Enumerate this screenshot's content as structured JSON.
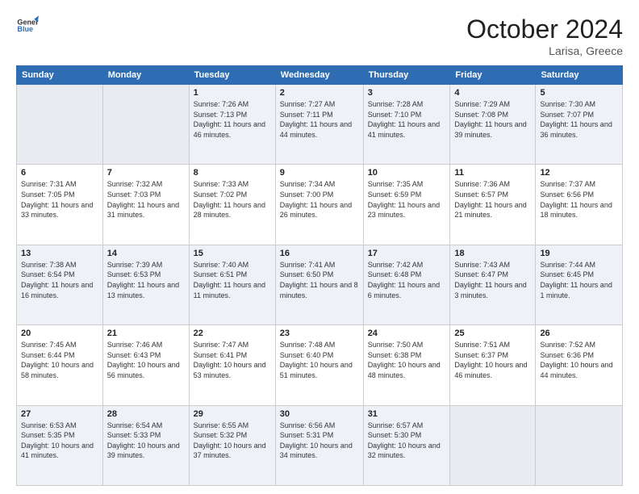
{
  "header": {
    "logo_general": "General",
    "logo_blue": "Blue",
    "month_title": "October 2024",
    "location": "Larisa, Greece"
  },
  "weekdays": [
    "Sunday",
    "Monday",
    "Tuesday",
    "Wednesday",
    "Thursday",
    "Friday",
    "Saturday"
  ],
  "weeks": [
    [
      {
        "day": "",
        "info": ""
      },
      {
        "day": "",
        "info": ""
      },
      {
        "day": "1",
        "info": "Sunrise: 7:26 AM\nSunset: 7:13 PM\nDaylight: 11 hours\nand 46 minutes."
      },
      {
        "day": "2",
        "info": "Sunrise: 7:27 AM\nSunset: 7:11 PM\nDaylight: 11 hours\nand 44 minutes."
      },
      {
        "day": "3",
        "info": "Sunrise: 7:28 AM\nSunset: 7:10 PM\nDaylight: 11 hours\nand 41 minutes."
      },
      {
        "day": "4",
        "info": "Sunrise: 7:29 AM\nSunset: 7:08 PM\nDaylight: 11 hours\nand 39 minutes."
      },
      {
        "day": "5",
        "info": "Sunrise: 7:30 AM\nSunset: 7:07 PM\nDaylight: 11 hours\nand 36 minutes."
      }
    ],
    [
      {
        "day": "6",
        "info": "Sunrise: 7:31 AM\nSunset: 7:05 PM\nDaylight: 11 hours\nand 33 minutes."
      },
      {
        "day": "7",
        "info": "Sunrise: 7:32 AM\nSunset: 7:03 PM\nDaylight: 11 hours\nand 31 minutes."
      },
      {
        "day": "8",
        "info": "Sunrise: 7:33 AM\nSunset: 7:02 PM\nDaylight: 11 hours\nand 28 minutes."
      },
      {
        "day": "9",
        "info": "Sunrise: 7:34 AM\nSunset: 7:00 PM\nDaylight: 11 hours\nand 26 minutes."
      },
      {
        "day": "10",
        "info": "Sunrise: 7:35 AM\nSunset: 6:59 PM\nDaylight: 11 hours\nand 23 minutes."
      },
      {
        "day": "11",
        "info": "Sunrise: 7:36 AM\nSunset: 6:57 PM\nDaylight: 11 hours\nand 21 minutes."
      },
      {
        "day": "12",
        "info": "Sunrise: 7:37 AM\nSunset: 6:56 PM\nDaylight: 11 hours\nand 18 minutes."
      }
    ],
    [
      {
        "day": "13",
        "info": "Sunrise: 7:38 AM\nSunset: 6:54 PM\nDaylight: 11 hours\nand 16 minutes."
      },
      {
        "day": "14",
        "info": "Sunrise: 7:39 AM\nSunset: 6:53 PM\nDaylight: 11 hours\nand 13 minutes."
      },
      {
        "day": "15",
        "info": "Sunrise: 7:40 AM\nSunset: 6:51 PM\nDaylight: 11 hours\nand 11 minutes."
      },
      {
        "day": "16",
        "info": "Sunrise: 7:41 AM\nSunset: 6:50 PM\nDaylight: 11 hours\nand 8 minutes."
      },
      {
        "day": "17",
        "info": "Sunrise: 7:42 AM\nSunset: 6:48 PM\nDaylight: 11 hours\nand 6 minutes."
      },
      {
        "day": "18",
        "info": "Sunrise: 7:43 AM\nSunset: 6:47 PM\nDaylight: 11 hours\nand 3 minutes."
      },
      {
        "day": "19",
        "info": "Sunrise: 7:44 AM\nSunset: 6:45 PM\nDaylight: 11 hours\nand 1 minute."
      }
    ],
    [
      {
        "day": "20",
        "info": "Sunrise: 7:45 AM\nSunset: 6:44 PM\nDaylight: 10 hours\nand 58 minutes."
      },
      {
        "day": "21",
        "info": "Sunrise: 7:46 AM\nSunset: 6:43 PM\nDaylight: 10 hours\nand 56 minutes."
      },
      {
        "day": "22",
        "info": "Sunrise: 7:47 AM\nSunset: 6:41 PM\nDaylight: 10 hours\nand 53 minutes."
      },
      {
        "day": "23",
        "info": "Sunrise: 7:48 AM\nSunset: 6:40 PM\nDaylight: 10 hours\nand 51 minutes."
      },
      {
        "day": "24",
        "info": "Sunrise: 7:50 AM\nSunset: 6:38 PM\nDaylight: 10 hours\nand 48 minutes."
      },
      {
        "day": "25",
        "info": "Sunrise: 7:51 AM\nSunset: 6:37 PM\nDaylight: 10 hours\nand 46 minutes."
      },
      {
        "day": "26",
        "info": "Sunrise: 7:52 AM\nSunset: 6:36 PM\nDaylight: 10 hours\nand 44 minutes."
      }
    ],
    [
      {
        "day": "27",
        "info": "Sunrise: 6:53 AM\nSunset: 5:35 PM\nDaylight: 10 hours\nand 41 minutes."
      },
      {
        "day": "28",
        "info": "Sunrise: 6:54 AM\nSunset: 5:33 PM\nDaylight: 10 hours\nand 39 minutes."
      },
      {
        "day": "29",
        "info": "Sunrise: 6:55 AM\nSunset: 5:32 PM\nDaylight: 10 hours\nand 37 minutes."
      },
      {
        "day": "30",
        "info": "Sunrise: 6:56 AM\nSunset: 5:31 PM\nDaylight: 10 hours\nand 34 minutes."
      },
      {
        "day": "31",
        "info": "Sunrise: 6:57 AM\nSunset: 5:30 PM\nDaylight: 10 hours\nand 32 minutes."
      },
      {
        "day": "",
        "info": ""
      },
      {
        "day": "",
        "info": ""
      }
    ]
  ]
}
